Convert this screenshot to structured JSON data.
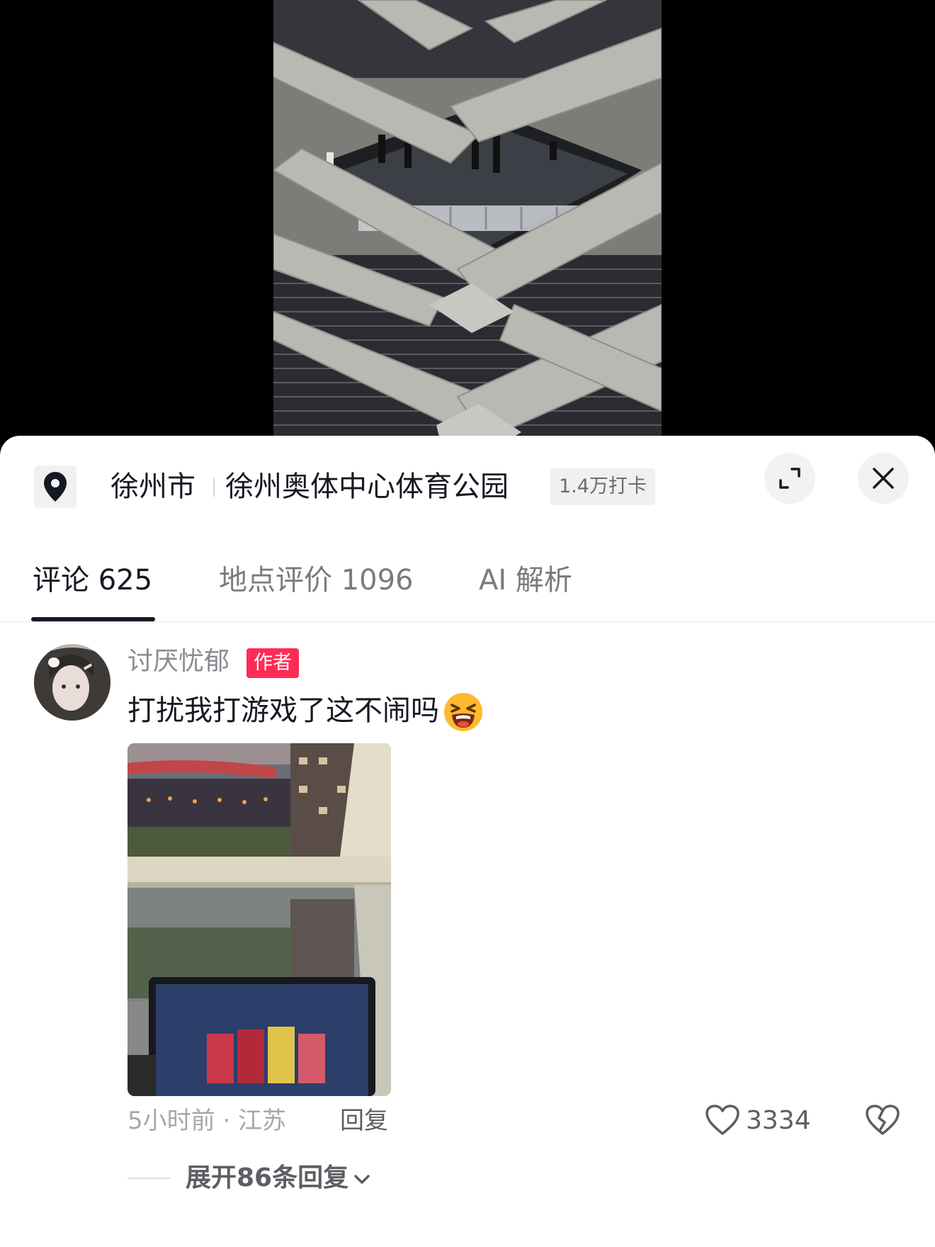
{
  "location": {
    "city": "徐州市",
    "place": "徐州奥体中心体育公园",
    "checkins": "1.4万打卡",
    "pin_icon": "location-pin-icon"
  },
  "tabs": [
    {
      "label": "评论 625",
      "active": true
    },
    {
      "label": "地点评价 1096",
      "active": false
    },
    {
      "label": "AI 解析",
      "active": false
    }
  ],
  "comment": {
    "username": "讨厌忧郁",
    "author_tag": "作者",
    "text": "打扰我打游戏了这不闹吗",
    "emoji": "grinning-squinting-face",
    "time_location": "5小时前 · 江苏",
    "reply_label": "回复",
    "likes": "3334",
    "expand_label": "展开86条回复"
  },
  "colors": {
    "accent": "#fe2c55",
    "text_primary": "#161823",
    "text_secondary": "#8a8b91"
  }
}
